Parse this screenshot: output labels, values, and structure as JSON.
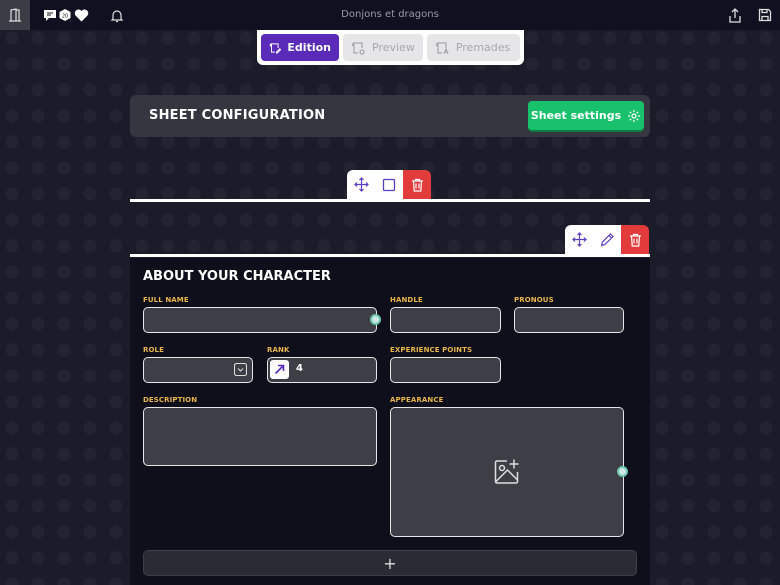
{
  "topbar": {
    "title": "Donjons et dragons",
    "left_icons": [
      "exit-door-icon",
      "chat-icon",
      "dice-icon",
      "heart-icon",
      "bell-icon"
    ],
    "right_icons": [
      "share-icon",
      "save-icon"
    ]
  },
  "modes": {
    "tabs": [
      {
        "label": "Edition",
        "icon": "scroll-pen-icon",
        "active": true
      },
      {
        "label": "Preview",
        "icon": "scroll-eye-icon",
        "active": false
      },
      {
        "label": "Premades",
        "icon": "scroll-a-icon",
        "active": false
      }
    ]
  },
  "config": {
    "title": "SHEET CONFIGURATION",
    "settings_label": "Sheet settings"
  },
  "colors": {
    "accent_purple": "#5a2ab8",
    "accent_green": "#19c16d",
    "danger_red": "#e23b3b",
    "label_gold": "#e8b54a"
  },
  "section": {
    "title": "ABOUT YOUR CHARACTER",
    "fields": {
      "full_name": {
        "label": "FULL NAME",
        "value": ""
      },
      "handle": {
        "label": "HANDLE",
        "value": ""
      },
      "pronous": {
        "label": "PRONOUS",
        "value": ""
      },
      "role": {
        "label": "ROLE",
        "value": ""
      },
      "rank": {
        "label": "RANK",
        "value": "4"
      },
      "experience": {
        "label": "EXPERIENCE POINTS",
        "value": ""
      },
      "description": {
        "label": "DESCRIPTION",
        "value": ""
      },
      "appearance": {
        "label": "APPEARANCE"
      }
    },
    "add_label": "+"
  }
}
